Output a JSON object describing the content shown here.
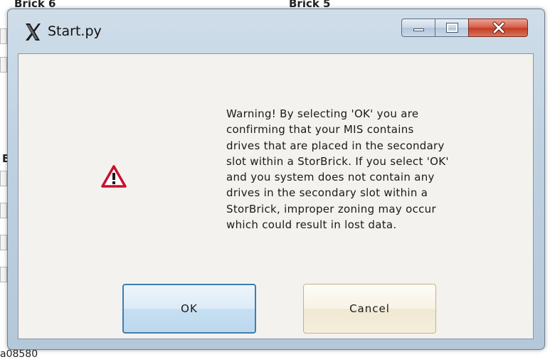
{
  "background": {
    "label_left": "Brick 6",
    "label_right": "Brick 5",
    "label_side": "B",
    "footer_code": "a08580"
  },
  "window": {
    "title": "Start.py",
    "title_icon": "x-logo-icon",
    "controls": {
      "minimize": "minimize-icon",
      "maximize": "maximize-icon",
      "close": "close-icon"
    }
  },
  "dialog": {
    "icon": "warning-icon",
    "message": "Warning! By selecting 'OK' you are\nconfirming that your MIS contains\ndrives that are placed in the secondary\nslot within a StorBrick. If you select 'OK'\nand you system does not contain any\ndrives in the secondary slot within a\nStorBrick, improper zoning may occur\nwhich could result in lost data.",
    "ok_label": "OK",
    "cancel_label": "Cancel"
  },
  "colors": {
    "close_button": "#c33d24",
    "ok_border": "#3c7fb1",
    "warning_red": "#c8102e"
  }
}
